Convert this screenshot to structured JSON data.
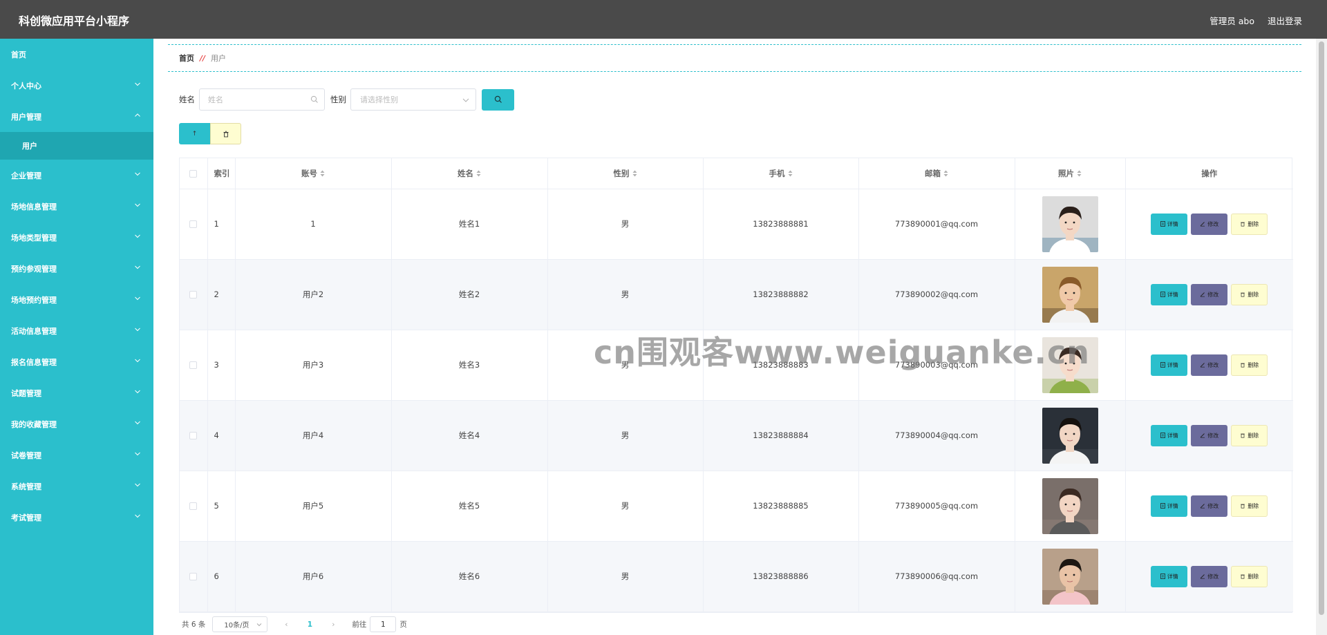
{
  "header": {
    "title": "科创微应用平台小程序",
    "user_label": "管理员 abo",
    "logout_label": "退出登录"
  },
  "sidebar": {
    "items": [
      {
        "label": "首页",
        "has_chevron": false
      },
      {
        "label": "个人中心",
        "has_chevron": true,
        "expanded": false
      },
      {
        "label": "用户管理",
        "has_chevron": true,
        "expanded": true,
        "children": [
          "用户"
        ]
      },
      {
        "label": "企业管理",
        "has_chevron": true,
        "expanded": false
      },
      {
        "label": "场地信息管理",
        "has_chevron": true,
        "expanded": false
      },
      {
        "label": "场地类型管理",
        "has_chevron": true,
        "expanded": false
      },
      {
        "label": "预约参观管理",
        "has_chevron": true,
        "expanded": false
      },
      {
        "label": "场地预约管理",
        "has_chevron": true,
        "expanded": false
      },
      {
        "label": "活动信息管理",
        "has_chevron": true,
        "expanded": false
      },
      {
        "label": "报名信息管理",
        "has_chevron": true,
        "expanded": false
      },
      {
        "label": "试题管理",
        "has_chevron": true,
        "expanded": false
      },
      {
        "label": "我的收藏管理",
        "has_chevron": true,
        "expanded": false
      },
      {
        "label": "试卷管理",
        "has_chevron": true,
        "expanded": false
      },
      {
        "label": "系统管理",
        "has_chevron": true,
        "expanded": false
      },
      {
        "label": "考试管理",
        "has_chevron": true,
        "expanded": false
      }
    ]
  },
  "breadcrumb": {
    "home": "首页",
    "separator": "//",
    "current": "用户"
  },
  "search": {
    "name_label": "姓名",
    "name_placeholder": "姓名",
    "gender_label": "性别",
    "gender_placeholder": "请选择性别"
  },
  "actions": {
    "add_label": "↑"
  },
  "table": {
    "headers": {
      "index": "索引",
      "account": "账号",
      "name": "姓名",
      "gender": "性别",
      "phone": "手机",
      "email": "邮箱",
      "photo": "照片",
      "ops": "操作"
    },
    "op_labels": {
      "detail": "详情",
      "edit": "修改",
      "delete": "删除"
    },
    "rows": [
      {
        "index": "1",
        "account": "1",
        "name": "姓名1",
        "gender": "男",
        "phone": "13823888881",
        "email": "773890001@qq.com",
        "photo": {
          "bg": "#dcdcdc",
          "hair": "#2a1f1a",
          "skin": "#f3d7c4",
          "shirt": "#ffffff",
          "accent": "#2f6b8f"
        }
      },
      {
        "index": "2",
        "account": "用户2",
        "name": "姓名2",
        "gender": "男",
        "phone": "13823888882",
        "email": "773890002@qq.com",
        "photo": {
          "bg": "#c9a56a",
          "hair": "#8a5a2a",
          "skin": "#f0c9a8",
          "shirt": "#f2f2f2",
          "accent": "#3a2a1a"
        }
      },
      {
        "index": "3",
        "account": "用户3",
        "name": "姓名3",
        "gender": "男",
        "phone": "13823888883",
        "email": "773890003@qq.com",
        "photo": {
          "bg": "#e9e4dd",
          "hair": "#3a2a22",
          "skin": "#f6dccb",
          "shirt": "#8fb04a",
          "accent": "#8fb04a"
        }
      },
      {
        "index": "4",
        "account": "用户4",
        "name": "姓名4",
        "gender": "男",
        "phone": "13823888884",
        "email": "773890004@qq.com",
        "photo": {
          "bg": "#2a3038",
          "hair": "#15110e",
          "skin": "#f1d6c4",
          "shirt": "#f4f4f4",
          "accent": "#4a5058"
        }
      },
      {
        "index": "5",
        "account": "用户5",
        "name": "姓名5",
        "gender": "男",
        "phone": "13823888885",
        "email": "773890005@qq.com",
        "photo": {
          "bg": "#7a6f6a",
          "hair": "#3b2a22",
          "skin": "#f2d5c3",
          "shirt": "#5a5a5a",
          "accent": "#9a8a80"
        }
      },
      {
        "index": "6",
        "account": "用户6",
        "name": "姓名6",
        "gender": "男",
        "phone": "13823888886",
        "email": "773890006@qq.com",
        "photo": {
          "bg": "#b8a08a",
          "hair": "#1d1712",
          "skin": "#e9c3a6",
          "shirt": "#f3c4c8",
          "accent": "#6a5040"
        }
      }
    ]
  },
  "pagination": {
    "total": "共 6 条",
    "page_size": "10条/页",
    "prev": "‹",
    "current": "1",
    "next": "›",
    "goto_label": "前往",
    "goto_value": "1",
    "page_suffix": "页"
  },
  "watermark": "cn围观客www.weiguanke.cn",
  "colors": {
    "accent": "#2bbfcc",
    "header_bg": "#4a4a4a",
    "edit_btn": "#6b6b9c",
    "delete_btn": "#fefdd1"
  }
}
